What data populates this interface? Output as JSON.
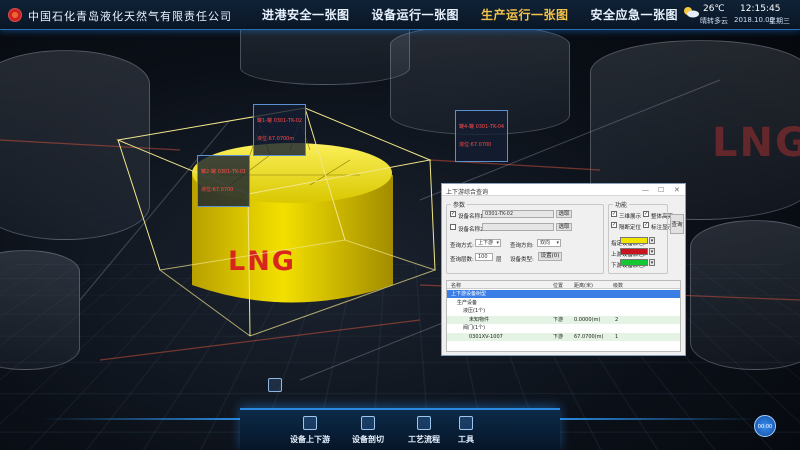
{
  "header": {
    "company": "中国石化青岛液化天然气有限责任公司",
    "nav": [
      {
        "label": "进港安全一张图",
        "active": false
      },
      {
        "label": "设备运行一张图",
        "active": false
      },
      {
        "label": "生产运行一张图",
        "active": true
      },
      {
        "label": "安全应急一张图",
        "active": false
      }
    ],
    "weather": {
      "icon": "partly-cloudy-icon",
      "temp": "26℃",
      "desc": "晴转多云"
    },
    "time": "12:15:45",
    "date": "2018.10.09",
    "weekday": "星期三"
  },
  "scene": {
    "tank_label": "LNG",
    "ghost_label": "LNG",
    "tags": [
      {
        "line1": "罐1-罐 0301-TK-02",
        "line2": "液位:67.0700m"
      },
      {
        "line1": "罐2-罐 0301-TK-01",
        "line2": "液位:67.0700"
      },
      {
        "line1": "罐4-罐 0301-TK-04",
        "line2": "液位:67.0700"
      }
    ]
  },
  "dialog": {
    "title": "上下游综合查询",
    "params_legend": "参数",
    "device1_label": "设备名称1:",
    "device1_value": "0301-TK-02",
    "device2_label": "设备名称2:",
    "device2_value": "",
    "select_label": "选取",
    "query_mode_label": "查询方式:",
    "query_mode_value": "上下游",
    "query_direction_label": "查询方向:",
    "query_direction_value": "双向",
    "depth_label": "查询层数:",
    "depth_value": "100",
    "depth_unit": "层",
    "device_type_label": "设备类型:",
    "device_type_button": "设置(0)",
    "function_legend": "功能",
    "fn_3d_highlight": "三维展示",
    "fn_overall_highlight": "整体高亮",
    "fn_isolate": "隔断定位",
    "fn_annotate": "标注显示",
    "color_start_label": "指定设备颜色:",
    "color_up_label": "上游设备颜色:",
    "color_down_label": "下游设备颜色:",
    "colors": {
      "start": "#f2e600",
      "up": "#c8141e",
      "down": "#14c832"
    },
    "query_button": "查询",
    "columns": [
      "名称",
      "位置",
      "距离(米)",
      "级数"
    ],
    "rows": [
      {
        "name": "上下游设备树型",
        "pos": "",
        "dist": "",
        "level": "",
        "indent": 0,
        "selected": true
      },
      {
        "name": "生产设备",
        "pos": "",
        "dist": "",
        "level": "",
        "indent": 1
      },
      {
        "name": "液压(1个)",
        "pos": "",
        "dist": "",
        "level": "",
        "indent": 2
      },
      {
        "name": "未知物件",
        "pos": "下游",
        "dist": "0.0000(m)",
        "level": "2",
        "indent": 3,
        "alt": true
      },
      {
        "name": "阀门(1个)",
        "pos": "",
        "dist": "",
        "level": "",
        "indent": 2
      },
      {
        "name": "0301XV-1007",
        "pos": "下游",
        "dist": "67.0700(m)",
        "level": "1",
        "indent": 3,
        "alt": true
      }
    ]
  },
  "toolbar": {
    "items": [
      {
        "label": "设备上下游",
        "icon": "updown-stream-icon"
      },
      {
        "label": "设备剖切",
        "icon": "section-cut-icon"
      },
      {
        "label": "工艺流程",
        "icon": "process-flow-icon"
      },
      {
        "label": "工具",
        "icon": "tools-icon"
      }
    ],
    "round_button": "00:00"
  }
}
